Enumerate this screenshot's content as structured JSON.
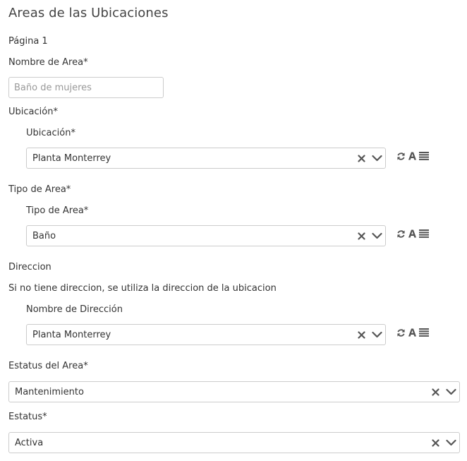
{
  "page": {
    "title": "Areas de las Ubicaciones",
    "page_label": "Página 1"
  },
  "nombre_area": {
    "label": "Nombre de Area*",
    "placeholder": "Baño de mujeres",
    "value": ""
  },
  "ubicacion": {
    "section_label": "Ubicación*",
    "field_label": "Ubicación*",
    "value": "Planta Monterrey"
  },
  "tipo_area": {
    "section_label": "Tipo de Area*",
    "field_label": "Tipo de Area*",
    "value": "Baño"
  },
  "direccion": {
    "section_label": "Direccion",
    "help_text": "Si no tiene direccion, se utiliza la direccion de la ubicacion",
    "field_label": "Nombre de Dirección",
    "value": "Planta Monterrey"
  },
  "estatus_area": {
    "label": "Estatus del Area*",
    "value": "Mantenimiento"
  },
  "estatus": {
    "label": "Estatus*",
    "value": "Activa"
  },
  "icons": {
    "clear": "clear-x-icon",
    "dropdown": "chevron-down-icon",
    "refresh": "refresh-icon",
    "add": "add-record-icon",
    "list": "list-icon"
  },
  "colors": {
    "border": "#cccccc",
    "icon": "#555555",
    "text": "#333333"
  }
}
